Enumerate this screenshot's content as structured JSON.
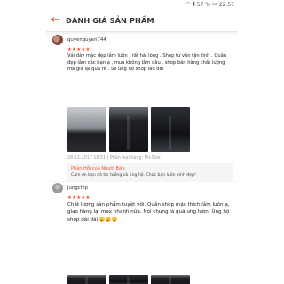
{
  "status_bar": {
    "time": "22:57",
    "battery_percent": "57 %",
    "icons": [
      "wifi-icon",
      "signal-icon",
      "battery-icon"
    ]
  },
  "header": {
    "back_icon": "back-arrow-icon",
    "title": "ĐÁNH GIÁ SẢN PHẨM"
  },
  "accent_color": "#ee4d2d",
  "reviews": [
    {
      "username": "quyenquyen744",
      "rating": 5,
      "stars": "★★★★★",
      "text": "Vải dày mặc đẹp lắm luôn , rất hài lòng . Shop tư vấn tận tình . Quần đẹp lắm các bạn ạ , mua không lâm đâu , shop bán hàng chất lượng mà giá lại quá rẻ . Sẽ ủng hộ shop lâu dài",
      "photos": 3,
      "meta": "28-12-2017 16:51 | Phân loại hàng: M+Size",
      "reply": {
        "label": "Phản Hồi của Người Bán:",
        "text": "Cảm ơn bạn đã tin tưởng và ủng hộ. Chúc bạn luôn xinh đẹp!"
      }
    },
    {
      "username": "jungchip",
      "rating": 5,
      "stars": "★★★★★",
      "text": "Chất lượng sản phẩm tuyệt vời. Quần shop mặc thích lắm luôn ạ, giao hàng lại max nhanh nữa. Nói chung là quá ưng luôn. Ủng hộ shop dài dài",
      "emoji_count": 3,
      "photos": 3
    }
  ]
}
